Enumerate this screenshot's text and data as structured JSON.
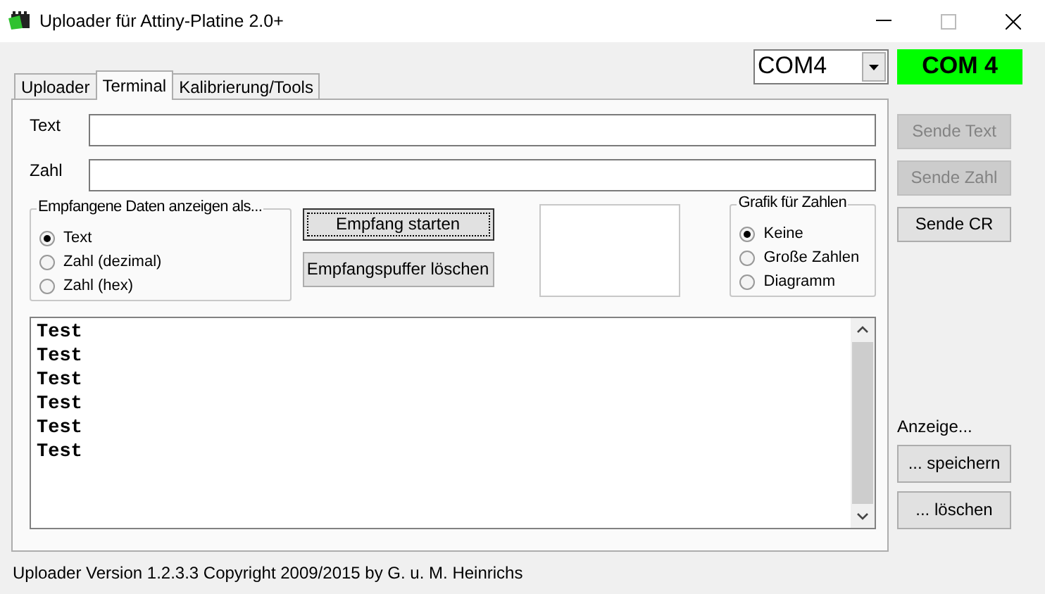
{
  "window": {
    "title": "Uploader für Attiny-Platine 2.0+"
  },
  "tabs": [
    {
      "label": "Uploader",
      "selected": false
    },
    {
      "label": "Terminal",
      "selected": true
    },
    {
      "label": "Kalibrierung/Tools",
      "selected": false
    }
  ],
  "port_select": {
    "value": "COM4"
  },
  "port_status": {
    "text": "COM 4",
    "connected": true
  },
  "fields": [
    {
      "label": "Text"
    },
    {
      "label": "Zahl"
    }
  ],
  "display_mode": {
    "legend": "Empfangene Daten anzeigen als...",
    "options": [
      {
        "label": "Text",
        "selected": true
      },
      {
        "label": "Zahl (dezimal)",
        "selected": false
      },
      {
        "label": "Zahl (hex)",
        "selected": false
      }
    ]
  },
  "receive_buttons": [
    {
      "label": "Empfang starten",
      "focused": true
    },
    {
      "label": "Empfangspuffer löschen",
      "focused": false
    }
  ],
  "graphic_mode": {
    "legend": "Grafik für Zahlen",
    "options": [
      {
        "label": "Keine",
        "selected": true
      },
      {
        "label": "Große Zahlen",
        "selected": false
      },
      {
        "label": "Diagramm",
        "selected": false
      }
    ]
  },
  "output": {
    "lines": [
      "Test",
      "Test",
      "Test",
      "Test",
      "Test",
      "Test"
    ]
  },
  "send_buttons": [
    {
      "label": "Sende Text",
      "disabled": true
    },
    {
      "label": "Sende Zahl",
      "disabled": true
    },
    {
      "label": "Sende CR",
      "disabled": false
    }
  ],
  "display_label": "Anzeige...",
  "display_buttons": [
    {
      "label": "... speichern"
    },
    {
      "label": "... löschen"
    }
  ],
  "status_bar": "Uploader Version 1.2.3.3 Copyright 2009/2015 by G. u. M. Heinrichs"
}
